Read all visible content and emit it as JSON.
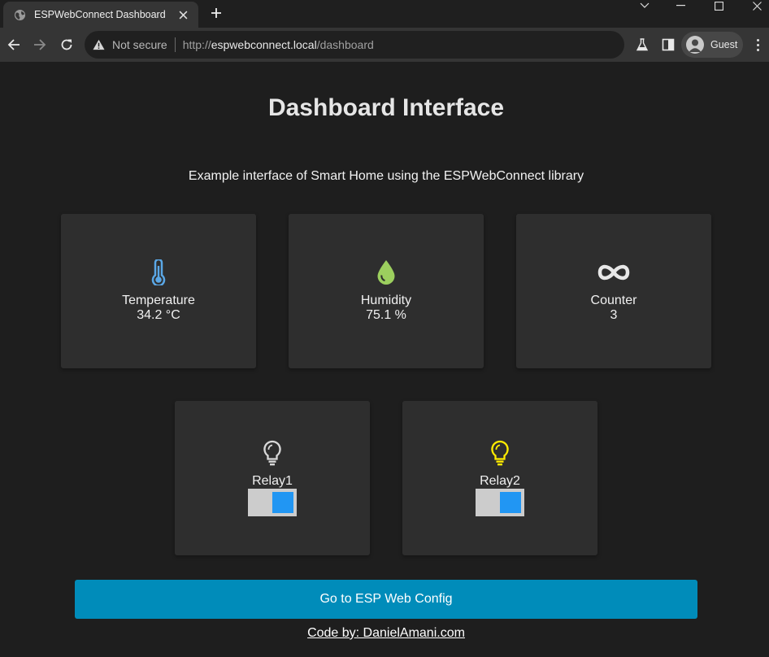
{
  "browser": {
    "tab_title": "ESPWebConnect Dashboard",
    "security_label": "Not secure",
    "url_scheme": "http://",
    "url_host": "espwebconnect.local",
    "url_path": "/dashboard",
    "profile_name": "Guest"
  },
  "page": {
    "heading": "Dashboard Interface",
    "subtitle": "Example interface of Smart Home using the ESPWebConnect library"
  },
  "sensors": [
    {
      "label": "Temperature",
      "value": "34.2 °C",
      "icon": "thermometer-icon",
      "color": "#5aa7e6"
    },
    {
      "label": "Humidity",
      "value": "75.1 %",
      "icon": "droplet-icon",
      "color": "#9ccf5e"
    },
    {
      "label": "Counter",
      "value": "3",
      "icon": "infinity-icon",
      "color": "#e8e8e8"
    }
  ],
  "relays": [
    {
      "label": "Relay1",
      "icon": "lightbulb-icon",
      "icon_color": "#d8d8d8",
      "state": "on"
    },
    {
      "label": "Relay2",
      "icon": "lightbulb-icon",
      "icon_color": "#ffeb00",
      "state": "on"
    }
  ],
  "config_button": "Go to ESP Web Config",
  "credit": "Code by: DanielAmani.com",
  "colors": {
    "background": "#1e1e1e",
    "card": "#2e2e2e",
    "button": "#008cba",
    "switch_knob": "#2196f3",
    "switch_track": "#cccccc"
  }
}
